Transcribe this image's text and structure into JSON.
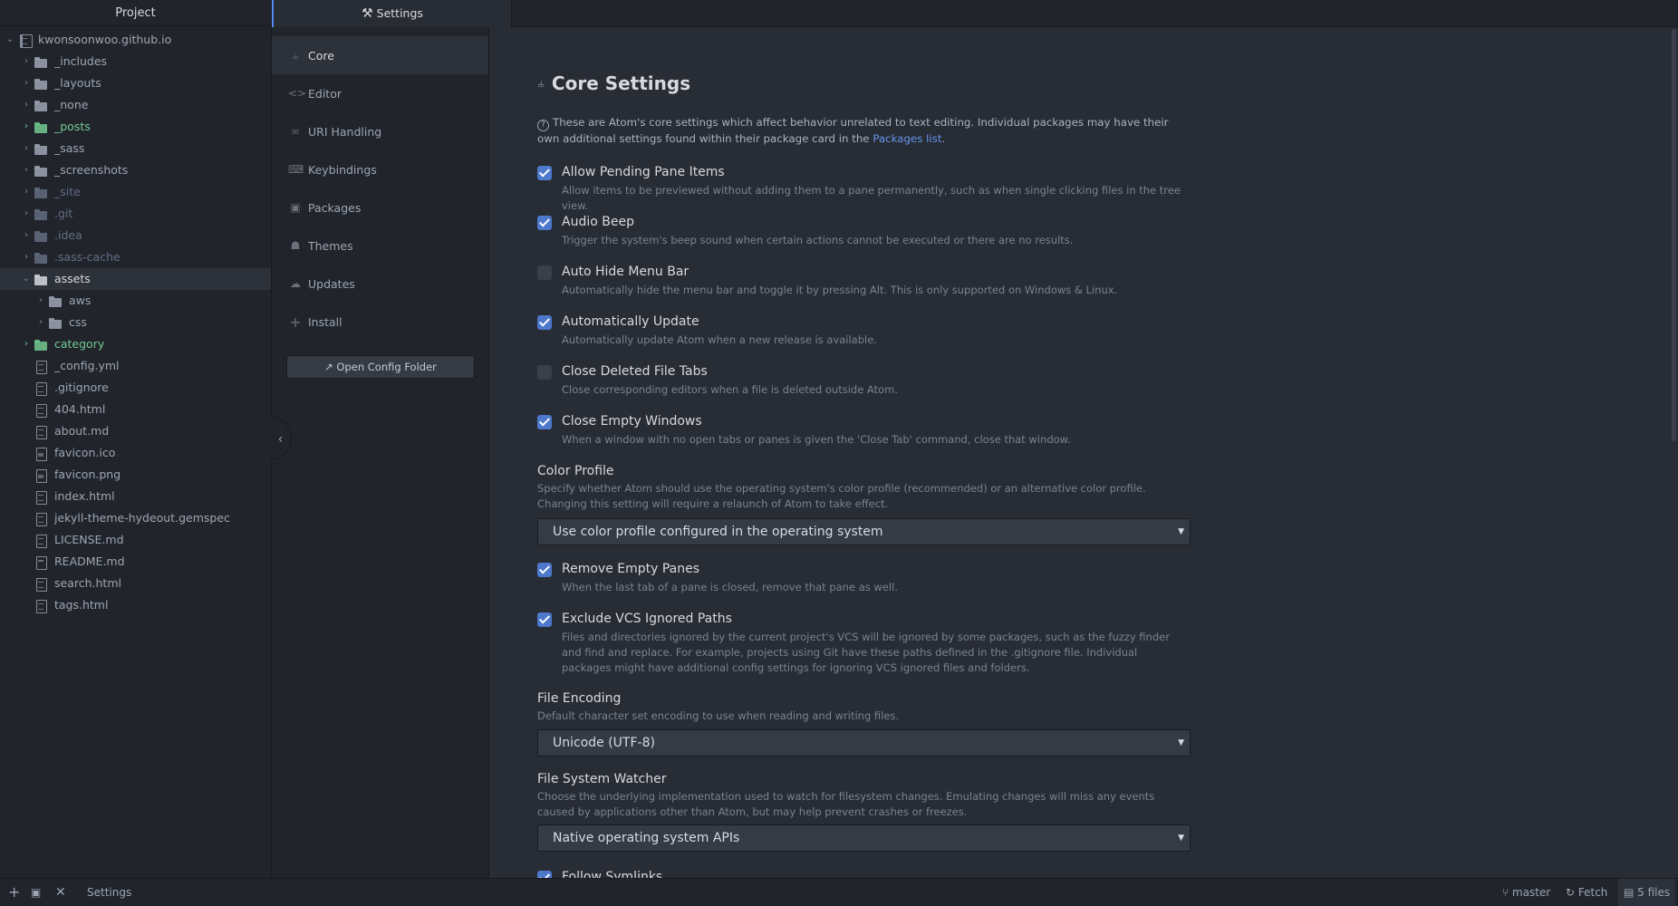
{
  "tree": {
    "header": "Project",
    "root": "kwonsoonwoo.github.io",
    "items": [
      {
        "label": "_includes",
        "state": "normal"
      },
      {
        "label": "_layouts",
        "state": "normal"
      },
      {
        "label": "_none",
        "state": "normal"
      },
      {
        "label": "_posts",
        "state": "added"
      },
      {
        "label": "_sass",
        "state": "normal"
      },
      {
        "label": "_screenshots",
        "state": "normal"
      },
      {
        "label": "_site",
        "state": "ignored"
      },
      {
        "label": ".git",
        "state": "ignored"
      },
      {
        "label": ".idea",
        "state": "ignored"
      },
      {
        "label": ".sass-cache",
        "state": "ignored"
      },
      {
        "label": "assets",
        "state": "selected"
      },
      {
        "label": "aws",
        "state": "normal"
      },
      {
        "label": "css",
        "state": "normal"
      },
      {
        "label": "category",
        "state": "added"
      },
      {
        "label": "_config.yml"
      },
      {
        "label": ".gitignore"
      },
      {
        "label": "404.html"
      },
      {
        "label": "about.md"
      },
      {
        "label": "favicon.ico"
      },
      {
        "label": "favicon.png"
      },
      {
        "label": "index.html"
      },
      {
        "label": "jekyll-theme-hydeout.gemspec"
      },
      {
        "label": "LICENSE.md"
      },
      {
        "label": "README.md"
      },
      {
        "label": "search.html"
      },
      {
        "label": "tags.html"
      }
    ]
  },
  "tab": {
    "label": "Settings"
  },
  "nav": {
    "items": [
      {
        "label": "Core",
        "icon": "sliders-icon"
      },
      {
        "label": "Editor",
        "icon": "code-icon"
      },
      {
        "label": "URI Handling",
        "icon": "link-icon"
      },
      {
        "label": "Keybindings",
        "icon": "keyboard-icon"
      },
      {
        "label": "Packages",
        "icon": "package-icon"
      },
      {
        "label": "Themes",
        "icon": "paintcan-icon"
      },
      {
        "label": "Updates",
        "icon": "cloud-download-icon"
      },
      {
        "label": "Install",
        "icon": "plus-icon"
      }
    ],
    "open_config": "Open Config Folder"
  },
  "main": {
    "title": "Core Settings",
    "intro": "These are Atom's core settings which affect behavior unrelated to text editing. Individual packages may have their own additional settings found within their package card in the",
    "intro_link": "Packages list",
    "settings": [
      {
        "title": "Allow Pending Pane Items",
        "desc": "Allow items to be previewed without adding them to a pane permanently, such as when single clicking files in the tree view.",
        "checked": true
      },
      {
        "title": "Audio Beep",
        "desc": "Trigger the system's beep sound when certain actions cannot be executed or there are no results.",
        "checked": true
      },
      {
        "title": "Auto Hide Menu Bar",
        "desc": "Automatically hide the menu bar and toggle it by pressing Alt. This is only supported on Windows & Linux.",
        "checked": false
      },
      {
        "title": "Automatically Update",
        "desc": "Automatically update Atom when a new release is available.",
        "checked": true
      },
      {
        "title": "Close Deleted File Tabs",
        "desc": "Close corresponding editors when a file is deleted outside Atom.",
        "checked": false
      },
      {
        "title": "Close Empty Windows",
        "desc": "When a window with no open tabs or panes is given the 'Close Tab' command, close that window.",
        "checked": true
      }
    ],
    "color_profile": {
      "title": "Color Profile",
      "desc1": "Specify whether Atom should use the operating system's color profile (recommended) or an alternative color profile.",
      "desc2": "Changing this setting will require a relaunch of Atom to take effect.",
      "value": "Use color profile configured in the operating system"
    },
    "settings2": [
      {
        "title": "Remove Empty Panes",
        "desc": "When the last tab of a pane is closed, remove that pane as well.",
        "checked": true
      },
      {
        "title": "Exclude VCS Ignored Paths",
        "desc": "Files and directories ignored by the current project's VCS will be ignored by some packages, such as the fuzzy finder and find and replace. For example, projects using Git have these paths defined in the .gitignore file. Individual packages might have additional config settings for ignoring VCS ignored files and folders.",
        "checked": true
      }
    ],
    "file_encoding": {
      "title": "File Encoding",
      "desc": "Default character set encoding to use when reading and writing files.",
      "value": "Unicode (UTF-8)"
    },
    "file_watcher": {
      "title": "File System Watcher",
      "desc": "Choose the underlying implementation used to watch for filesystem changes. Emulating changes will miss any events caused by applications other than Atom, but may help prevent crashes or freezes.",
      "value": "Native operating system APIs"
    },
    "follow_symlinks": {
      "title": "Follow Symlinks",
      "checked": true
    }
  },
  "status": {
    "file": "Settings",
    "branch": "master",
    "fetch": "Fetch",
    "files": "5 files"
  },
  "colors": {
    "accent": "#568af2",
    "checkbox": "#4d78cc",
    "added": "#73c990",
    "ignored": "#636d83",
    "link": "#6494ed"
  }
}
